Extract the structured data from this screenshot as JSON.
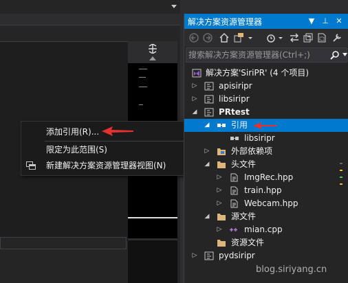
{
  "context_menu": {
    "items": [
      {
        "label": "添加引用(R)..."
      },
      {
        "label": "限定为此范围(S)"
      },
      {
        "label": "新建解决方案资源管理器视图(N)"
      }
    ]
  },
  "solution_explorer": {
    "title": "解决方案资源管理器",
    "title_buttons": [
      "▼",
      "⊥",
      "✕"
    ],
    "search_placeholder": "搜索解决方案资源管理器(Ctrl+;)",
    "tree": [
      {
        "label": "解决方案'SiriPR' (4 个项目)",
        "icon": "solution-icon",
        "expander": ""
      },
      {
        "label": "apisiripr",
        "icon": "cpp-project-icon",
        "expander": "▷"
      },
      {
        "label": "libsiripr",
        "icon": "cpp-project-icon",
        "expander": "▷"
      },
      {
        "label": "PRtest",
        "icon": "cpp-project-icon",
        "expander": "◢"
      },
      {
        "label": "引用",
        "icon": "references-icon",
        "expander": "◢"
      },
      {
        "label": "libsiripr",
        "icon": "reference-icon",
        "expander": ""
      },
      {
        "label": "外部依赖项",
        "icon": "external-deps-icon",
        "expander": "▷"
      },
      {
        "label": "头文件",
        "icon": "folder-icon",
        "expander": "◢"
      },
      {
        "label": "ImgRec.hpp",
        "icon": "header-file-icon",
        "expander": "▷"
      },
      {
        "label": "train.hpp",
        "icon": "header-file-icon",
        "expander": "▷"
      },
      {
        "label": "Webcam.hpp",
        "icon": "header-file-icon",
        "expander": "▷"
      },
      {
        "label": "源文件",
        "icon": "folder-icon",
        "expander": "◢"
      },
      {
        "label": "mian.cpp",
        "icon": "cpp-file-icon",
        "expander": "▷"
      },
      {
        "label": "资源文件",
        "icon": "folder-icon",
        "expander": ""
      },
      {
        "label": "pydsiripr",
        "icon": "cpp-project-icon",
        "expander": "▷"
      }
    ]
  },
  "watermark": "blog.siriyang.cn",
  "colors": {
    "accent": "#007acc",
    "annotation_arrow": "#e8312f",
    "folder": "#dcb67a"
  }
}
